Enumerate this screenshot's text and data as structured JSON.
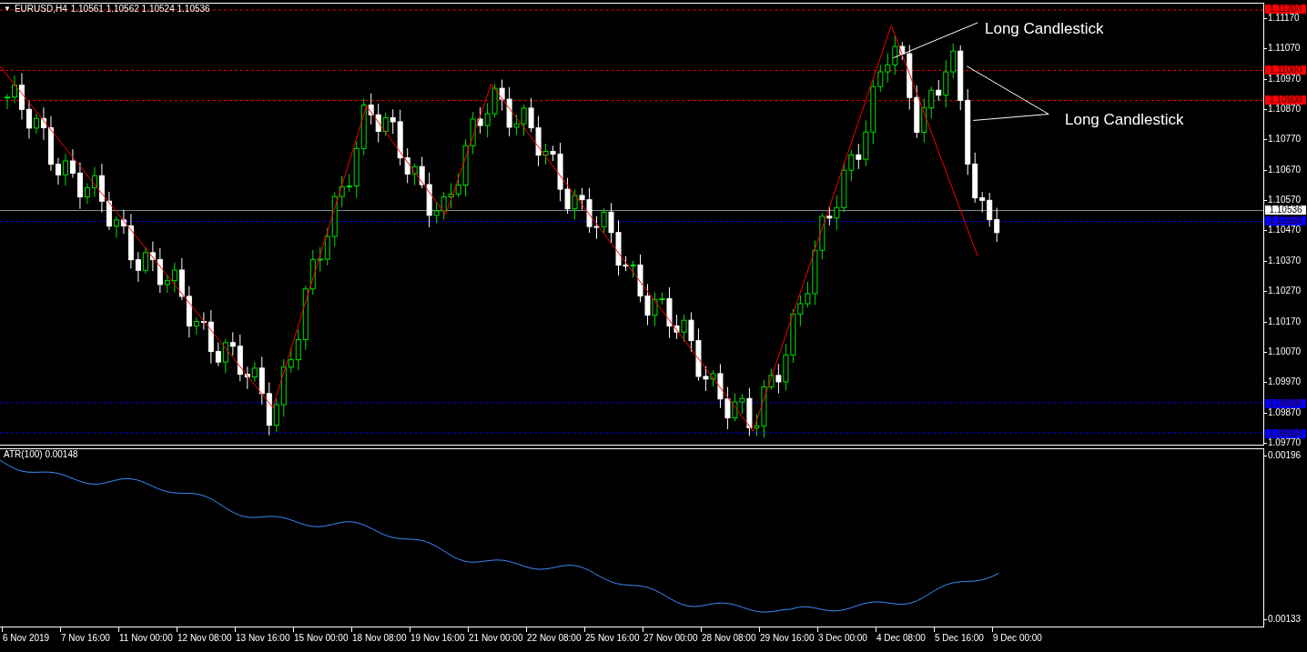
{
  "header": {
    "menu_marker": "▼",
    "symbol": "EURUSD,H4",
    "ohlc": "1.10561 1.10562 1.10524 1.10536"
  },
  "price_axis": {
    "ticks": [
      "1.11170",
      "1.11070",
      "1.10970",
      "1.10870",
      "1.10770",
      "1.10670",
      "1.10570",
      "1.10470",
      "1.10370",
      "1.10270",
      "1.10170",
      "1.10070",
      "1.09970",
      "1.09870",
      "1.09770"
    ]
  },
  "levels": [
    {
      "label": "1.11200",
      "color": "#ff0000"
    },
    {
      "label": "1.11000",
      "color": "#ff0000"
    },
    {
      "label": "1.10900",
      "color": "#ff0000"
    },
    {
      "label": "1.10500",
      "color": "#0000ff"
    },
    {
      "label": "1.09900",
      "color": "#0000ff"
    },
    {
      "label": "1.09800",
      "color": "#0000ff"
    }
  ],
  "current_price": "1.10536",
  "annotations": [
    {
      "text": "Long Candlestick"
    },
    {
      "text": "Long Candlestick"
    }
  ],
  "indicator": {
    "title": "ATR(100) 0.00148",
    "axis_ticks": [
      "0.00196",
      "0.00133"
    ]
  },
  "time_axis": [
    "6 Nov 2019",
    "7 Nov 16:00",
    "11 Nov 00:00",
    "12 Nov 08:00",
    "13 Nov 16:00",
    "15 Nov 00:00",
    "18 Nov 08:00",
    "19 Nov 16:00",
    "21 Nov 00:00",
    "22 Nov 08:00",
    "25 Nov 16:00",
    "27 Nov 00:00",
    "28 Nov 08:00",
    "29 Nov 16:00",
    "3 Dec 00:00",
    "4 Dec 08:00",
    "5 Dec 16:00",
    "9 Dec 00:00"
  ]
}
